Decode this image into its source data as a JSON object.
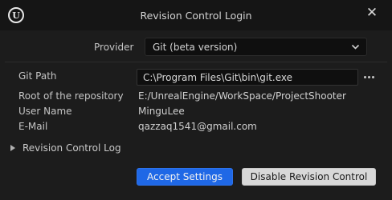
{
  "window": {
    "title": "Revision Control Login",
    "logo_letter": "U",
    "close_glyph": "✕"
  },
  "provider": {
    "label": "Provider",
    "selected": "Git  (beta version)"
  },
  "git_path": {
    "label": "Git Path",
    "value": "C:\\Program Files\\Git\\bin\\git.exe",
    "browse_icon": "ellipsis-icon"
  },
  "info": {
    "repo_root_label": "Root of the repository",
    "repo_root_value": "E:/UnrealEngine/WorkSpace/ProjectShooter",
    "user_name_label": "User Name",
    "user_name_value": "MinguLee",
    "email_label": "E-Mail",
    "email_value": "qazzaq1541@gmail.com"
  },
  "log": {
    "label": "Revision Control Log"
  },
  "buttons": {
    "accept": "Accept Settings",
    "disable": "Disable Revision Control"
  },
  "colors": {
    "accent": "#1f68e6",
    "background": "#1c1c1c",
    "titlebar": "#151515"
  }
}
